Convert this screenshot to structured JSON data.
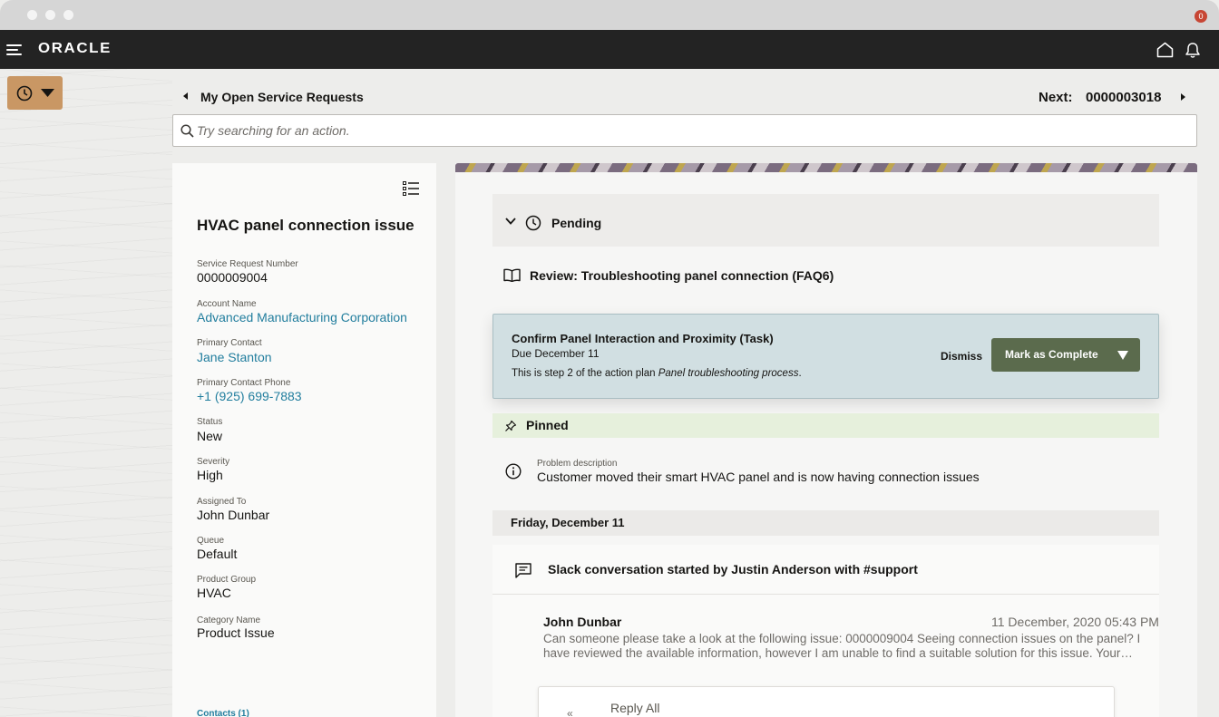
{
  "nav": {
    "logo": "ORACLE",
    "notification_count": "0"
  },
  "header": {
    "back_label": "My Open Service Requests",
    "next_label": "Next:",
    "next_number": "0000003018"
  },
  "search": {
    "placeholder": "Try searching for an action."
  },
  "record": {
    "title": "HVAC panel connection issue",
    "fields": [
      {
        "label": "Service Request Number",
        "value": "0000009004"
      },
      {
        "label": "Account Name",
        "value": "Advanced Manufacturing Corporation"
      },
      {
        "label": "Primary Contact",
        "value": "Jane Stanton"
      },
      {
        "label": "Primary Contact Phone",
        "value": "+1 (925) 699-7883"
      },
      {
        "label": "Status",
        "value": "New"
      },
      {
        "label": "Severity",
        "value": "High"
      },
      {
        "label": "Assigned To",
        "value": "John Dunbar"
      },
      {
        "label": "Queue",
        "value": "Default"
      },
      {
        "label": "Product Group",
        "value": "HVAC"
      },
      {
        "label": "Category Name",
        "value": "Product Issue"
      }
    ],
    "contacts_link": "Contacts (1)"
  },
  "activity": {
    "pending_label": "Pending",
    "review_label": "Review: Troubleshooting panel connection (FAQ6)",
    "task": {
      "title": "Confirm Panel Interaction and Proximity (Task)",
      "due": "Due December 11",
      "desc_prefix": "This is step 2 of the action plan ",
      "desc_plan": "Panel troubleshooting process",
      "desc_suffix": ".",
      "dismiss_label": "Dismiss",
      "complete_label": "Mark as Complete"
    },
    "pinned_label": "Pinned",
    "problem": {
      "label": "Problem description",
      "value": "Customer moved their smart HVAC panel and is now having connection issues"
    },
    "date_header": "Friday, December 11",
    "slack": {
      "title": "Slack conversation started by Justin Anderson with #support",
      "author": "John Dunbar",
      "timestamp": "11 December, 2020 05:43 PM",
      "body": "Can someone please take a look at the following issue: 0000009004 Seeing connection issues on the panel? I have reviewed the available information, however I am unable to find a suitable solution for this issue. Your…",
      "reply_label": "Reply All"
    }
  },
  "colors": {
    "history_button": "#c99764",
    "complete_button": "#5b6b4d",
    "task_card": "#d1dfe2",
    "pinned_row": "#e6f0dc",
    "link": "#227e9e",
    "badge": "#c74634"
  }
}
